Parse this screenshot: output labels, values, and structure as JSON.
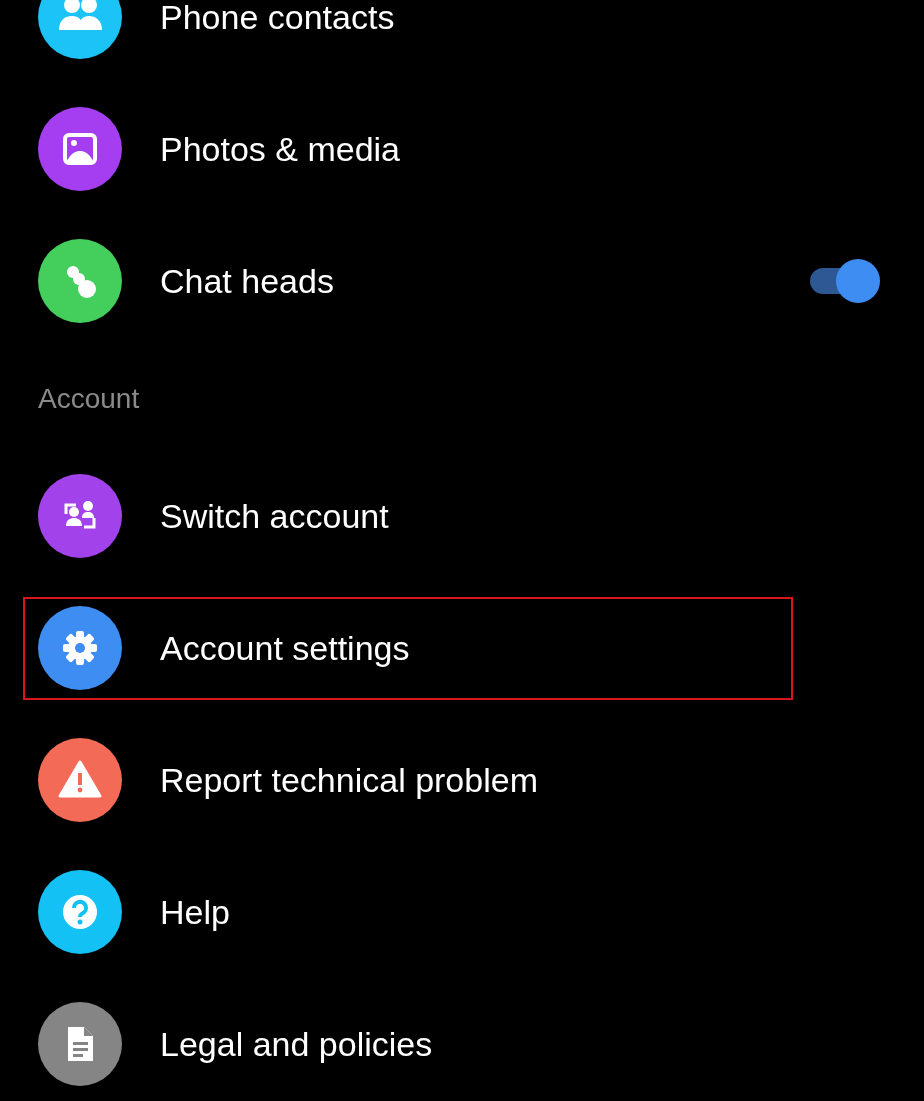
{
  "sections": [
    {
      "items": [
        {
          "label": "Phone contacts",
          "color": "#1cc3f7"
        },
        {
          "label": "Photos & media",
          "color": "#a53ef0"
        },
        {
          "label": "Chat heads",
          "color": "#44cf5d",
          "kind": "toggle",
          "on": true
        }
      ]
    },
    {
      "title": "Account",
      "items": [
        {
          "label": "Switch account",
          "color": "#a242eb"
        },
        {
          "label": "Account settings",
          "color": "#3e8df2",
          "highlighted": true
        },
        {
          "label": "Report technical problem",
          "color": "#f36a56"
        },
        {
          "label": "Help",
          "color": "#14c1f5"
        },
        {
          "label": "Legal and policies",
          "color": "#858585"
        }
      ]
    }
  ]
}
